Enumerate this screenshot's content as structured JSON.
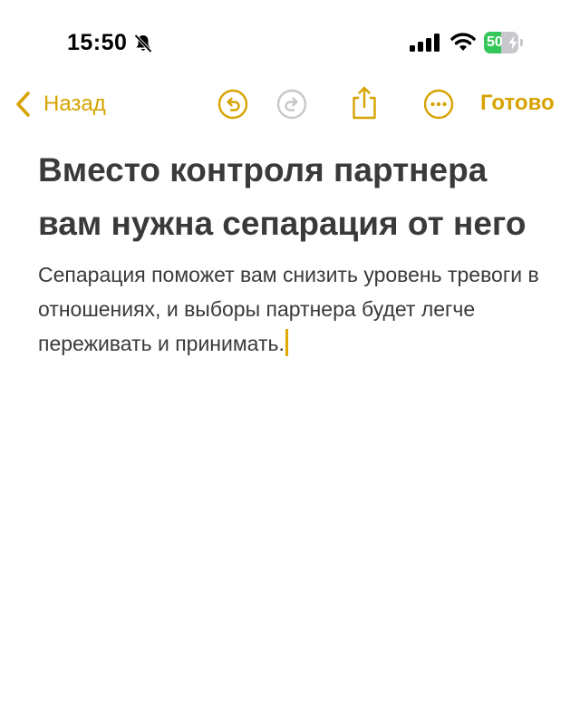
{
  "status_bar": {
    "time": "15:50",
    "battery_percent": "50",
    "battery_level": 0.5,
    "icons": [
      "bell-slash-icon",
      "cellular-signal-icon",
      "wifi-icon",
      "battery-charging-icon"
    ]
  },
  "toolbar": {
    "back_label": "Назад",
    "done_label": "Готово",
    "icons": [
      "chevron-left-icon",
      "undo-icon",
      "redo-icon",
      "share-icon",
      "more-icon"
    ]
  },
  "note": {
    "title": "Вместо контроля партнера вам нужна сепарация от него",
    "body": "Сепарация поможет вам снизить уровень тревоги в отношениях, и выборы партнера будет легче переживать и принимать."
  },
  "colors": {
    "accent": "#d7a300",
    "text": "#3a3a3c",
    "disabled": "#c7c7cc",
    "battery_green": "#34c759"
  }
}
